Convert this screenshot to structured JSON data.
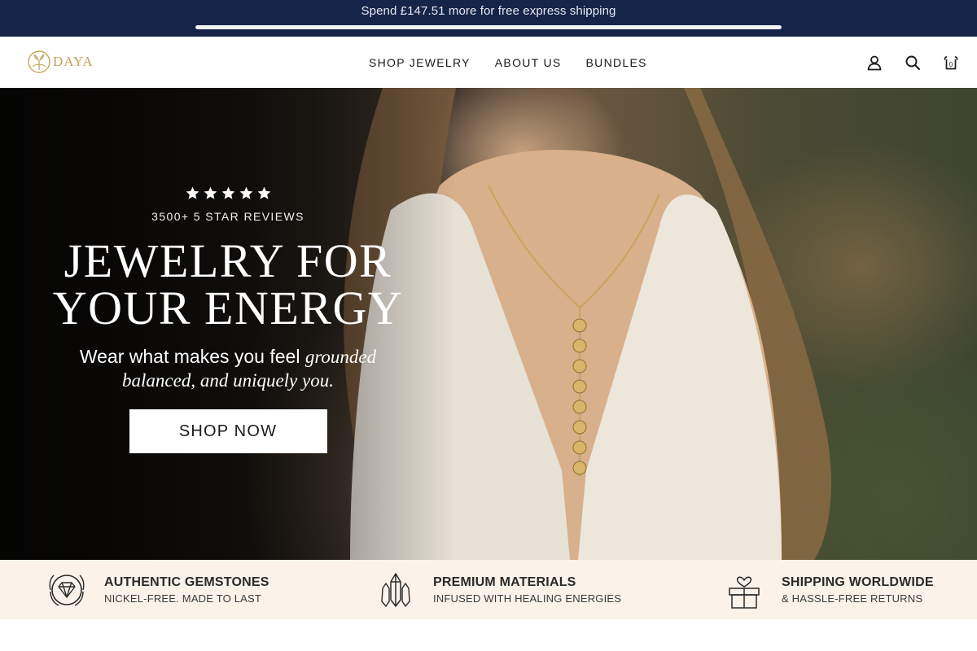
{
  "announcement": {
    "text": "Spend £147.51 more for free express shipping",
    "progress_fraction": 1.0
  },
  "header": {
    "logo_text": "DAYA",
    "nav": [
      {
        "label": "SHOP JEWELRY"
      },
      {
        "label": "ABOUT US"
      },
      {
        "label": "BUNDLES"
      }
    ],
    "icons": [
      "account-icon",
      "search-icon",
      "cart-icon"
    ],
    "cart_count": "0"
  },
  "hero": {
    "rating_stars": 5,
    "reviews_text": "3500+ 5 STAR REVIEWS",
    "title_line1": "JEWELRY FOR",
    "title_line2": "YOUR ENERGY",
    "subtitle_plain": "Wear what makes you feel",
    "subtitle_italic1": "grounded",
    "subtitle_italic2": "balanced, and uniquely you.",
    "cta_label": "SHOP NOW"
  },
  "usp": [
    {
      "icon": "diamond-badge-icon",
      "title": "AUTHENTIC GEMSTONES",
      "subtitle": "NICKEL-FREE. MADE TO LAST"
    },
    {
      "icon": "crystal-icon",
      "title": "PREMIUM MATERIALS",
      "subtitle": "INFUSED WITH HEALING ENERGIES"
    },
    {
      "icon": "gift-box-heart-icon",
      "title": "SHIPPING WORLDWIDE",
      "subtitle": "& HASSLE-FREE RETURNS"
    }
  ],
  "colors": {
    "announcement_bg": "#152449",
    "brand_gold": "#c5a257",
    "usp_bg": "#fbf3ea",
    "star_color": "#ffffff"
  }
}
